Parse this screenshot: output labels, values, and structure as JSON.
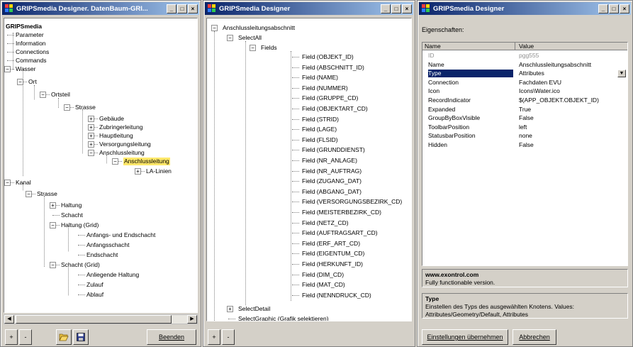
{
  "win1": {
    "title": "GRIPSmedia Designer. DatenBaum-GRI...",
    "tree": [
      {
        "label": "GRIPSmedia",
        "bold": true
      },
      {
        "label": "Parameter"
      },
      {
        "label": "Information"
      },
      {
        "label": "Connections"
      },
      {
        "label": "Commands"
      },
      {
        "label": "Wasser"
      },
      {
        "label": "Ort"
      },
      {
        "label": "Ortsteil"
      },
      {
        "label": "Strasse"
      },
      {
        "label": "Gebäude"
      },
      {
        "label": "Zubringerleitung"
      },
      {
        "label": "Hauptleitung"
      },
      {
        "label": "Versorgungsleitung"
      },
      {
        "label": "Anschlussleitung"
      },
      {
        "label": "Anschlussleitung"
      },
      {
        "label": "LA-Linien"
      },
      {
        "label": "Kanal"
      },
      {
        "label": "Strasse"
      },
      {
        "label": "Haltung"
      },
      {
        "label": "Schacht"
      },
      {
        "label": "Haltung (Grid)"
      },
      {
        "label": "Anfangs- und Endschacht"
      },
      {
        "label": "Anfangsschacht"
      },
      {
        "label": "Endschacht"
      },
      {
        "label": "Schacht (Grid)"
      },
      {
        "label": "Anliegende Haltung"
      },
      {
        "label": "Zulauf"
      },
      {
        "label": "Ablauf"
      }
    ],
    "btn_plus": "+",
    "btn_minus": "-",
    "btn_quit": "Beenden"
  },
  "win2": {
    "title": "GRIPSmedia Designer",
    "root": "Anschlussleitungsabschnitt",
    "select_all": "SelectAll",
    "fields": "Fields",
    "field_items": [
      "Field (OBJEKT_ID)",
      "Field (ABSCHNITT_ID)",
      "Field (NAME)",
      "Field (NUMMER)",
      "Field (GRUPPE_CD)",
      "Field (OBJEKTART_CD)",
      "Field (STRID)",
      "Field (LAGE)",
      "Field (FLSID)",
      "Field (GRUNDDIENST)",
      "Field (NR_ANLAGE)",
      "Field (NR_AUFTRAG)",
      "Field (ZUGANG_DAT)",
      "Field (ABGANG_DAT)",
      "Field (VERSORGUNGSBEZIRK_CD)",
      "Field (MEISTERBEZIRK_CD)",
      "Field (NETZ_CD)",
      "Field (AUFTRAGSART_CD)",
      "Field (ERF_ART_CD)",
      "Field (EIGENTUM_CD)",
      "Field (HERKUNFT_ID)",
      "Field (DIM_CD)",
      "Field (MAT_CD)",
      "Field (NENNDRUCK_CD)"
    ],
    "select_detail": "SelectDetail",
    "select_graphic": "SelectGraphic (Grafik selektieren)",
    "btn_plus": "+",
    "btn_minus": "-"
  },
  "win3": {
    "title": "GRIPSmedia Designer",
    "section_label": "Eigenschaften:",
    "col_name": "Name",
    "col_value": "Value",
    "rows": [
      {
        "name": "ID",
        "value": "pgg555"
      },
      {
        "name": "Name",
        "value": "Anschlussleitungsabschnitt"
      },
      {
        "name": "Type",
        "value": "Attributes"
      },
      {
        "name": "Connection",
        "value": "Fachdaten EVU"
      },
      {
        "name": "Icon",
        "value": "Icons\\Water.ico"
      },
      {
        "name": "RecordIndicator",
        "value": "$(APP_OBJEKT.OBJEKT_ID)"
      },
      {
        "name": "Expanded",
        "value": "True"
      },
      {
        "name": "GroupByBoxVisible",
        "value": "False"
      },
      {
        "name": "ToolbarPosition",
        "value": "left"
      },
      {
        "name": "StatusbarPosition",
        "value": "none"
      },
      {
        "name": "Hidden",
        "value": "False"
      }
    ],
    "promo_title": "www.exontrol.com",
    "promo_text": "Fully functionable version.",
    "help_title": "Type",
    "help_text": "Einstellen des Typs des ausgewählten Knotens. Values: Attributes/Geometry/Default, Attributes",
    "btn_apply": "Einstellungen übernehmen",
    "btn_cancel": "Abbrechen"
  },
  "icons": {
    "open": "folder-open-icon",
    "save": "floppy-disk-icon",
    "dropdown": "chevron-down-icon"
  },
  "colors": {
    "title_start": "#0a246a",
    "title_end": "#a6caf0",
    "selection_highlight": "#ffe86a",
    "property_selection": "#0a246a"
  }
}
